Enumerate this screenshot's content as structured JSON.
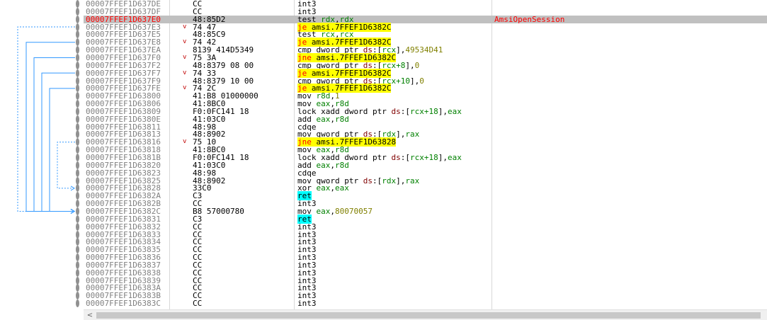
{
  "disassembly": {
    "rows": [
      {
        "addr": "00007FFEF1D637DE",
        "bytes": "CC",
        "expand": "",
        "instr": [
          {
            "t": "int3"
          }
        ],
        "comment": ""
      },
      {
        "addr": "00007FFEF1D637DF",
        "bytes": "CC",
        "expand": "",
        "instr": [
          {
            "t": "int3"
          }
        ],
        "comment": ""
      },
      {
        "addr": "00007FFEF1D637E0",
        "bytes": "48:85D2",
        "expand": "",
        "instr": [
          {
            "t": "test "
          },
          {
            "t": "rdx",
            "c": "reg"
          },
          {
            "t": ","
          },
          {
            "t": "rdx",
            "c": "reg"
          }
        ],
        "comment": "AmsiOpenSession",
        "selected": true,
        "rip": true
      },
      {
        "addr": "00007FFEF1D637E3",
        "bytes": "74 47",
        "expand": "v",
        "instr": [
          {
            "t": "je",
            "c": "jm"
          },
          {
            "t": " amsi.7FFEF1D6382C",
            "c": "jt"
          }
        ],
        "comment": ""
      },
      {
        "addr": "00007FFEF1D637E5",
        "bytes": "48:85C9",
        "expand": "",
        "instr": [
          {
            "t": "test "
          },
          {
            "t": "rcx",
            "c": "reg"
          },
          {
            "t": ","
          },
          {
            "t": "rcx",
            "c": "reg"
          }
        ],
        "comment": ""
      },
      {
        "addr": "00007FFEF1D637E8",
        "bytes": "74 42",
        "expand": "v",
        "instr": [
          {
            "t": "je",
            "c": "jm"
          },
          {
            "t": " amsi.7FFEF1D6382C",
            "c": "jt"
          }
        ],
        "comment": ""
      },
      {
        "addr": "00007FFEF1D637EA",
        "bytes": "8139 414D5349",
        "expand": "",
        "instr": [
          {
            "t": "cmp dword ptr "
          },
          {
            "t": "ds",
            "c": "seg"
          },
          {
            "t": ":["
          },
          {
            "t": "rcx",
            "c": "reg"
          },
          {
            "t": "],"
          },
          {
            "t": "49534D41",
            "c": "num"
          }
        ],
        "comment": ""
      },
      {
        "addr": "00007FFEF1D637F0",
        "bytes": "75 3A",
        "expand": "v",
        "instr": [
          {
            "t": "jne",
            "c": "jm"
          },
          {
            "t": " amsi.7FFEF1D6382C",
            "c": "jt"
          }
        ],
        "comment": ""
      },
      {
        "addr": "00007FFEF1D637F2",
        "bytes": "48:8379 08 00",
        "expand": "",
        "instr": [
          {
            "t": "cmp qword ptr "
          },
          {
            "t": "ds",
            "c": "seg"
          },
          {
            "t": ":["
          },
          {
            "t": "rcx+8",
            "c": "reg"
          },
          {
            "t": "],"
          },
          {
            "t": "0",
            "c": "num"
          }
        ],
        "comment": ""
      },
      {
        "addr": "00007FFEF1D637F7",
        "bytes": "74 33",
        "expand": "v",
        "instr": [
          {
            "t": "je",
            "c": "jm"
          },
          {
            "t": " amsi.7FFEF1D6382C",
            "c": "jt"
          }
        ],
        "comment": ""
      },
      {
        "addr": "00007FFEF1D637F9",
        "bytes": "48:8379 10 00",
        "expand": "",
        "instr": [
          {
            "t": "cmp qword ptr "
          },
          {
            "t": "ds",
            "c": "seg"
          },
          {
            "t": ":["
          },
          {
            "t": "rcx+10",
            "c": "reg"
          },
          {
            "t": "],"
          },
          {
            "t": "0",
            "c": "num"
          }
        ],
        "comment": ""
      },
      {
        "addr": "00007FFEF1D637FE",
        "bytes": "74 2C",
        "expand": "v",
        "instr": [
          {
            "t": "je",
            "c": "jm"
          },
          {
            "t": " amsi.7FFEF1D6382C",
            "c": "jt"
          }
        ],
        "comment": ""
      },
      {
        "addr": "00007FFEF1D63800",
        "bytes": "41:B8 01000000",
        "expand": "",
        "instr": [
          {
            "t": "mov "
          },
          {
            "t": "r8d",
            "c": "reg"
          },
          {
            "t": ","
          },
          {
            "t": "1",
            "c": "num"
          }
        ],
        "comment": ""
      },
      {
        "addr": "00007FFEF1D63806",
        "bytes": "41:8BC0",
        "expand": "",
        "instr": [
          {
            "t": "mov "
          },
          {
            "t": "eax",
            "c": "reg"
          },
          {
            "t": ","
          },
          {
            "t": "r8d",
            "c": "reg"
          }
        ],
        "comment": ""
      },
      {
        "addr": "00007FFEF1D63809",
        "bytes": "F0:0FC141 18",
        "expand": "",
        "instr": [
          {
            "t": "lock xadd dword ptr "
          },
          {
            "t": "ds",
            "c": "seg"
          },
          {
            "t": ":["
          },
          {
            "t": "rcx+18",
            "c": "reg"
          },
          {
            "t": "],"
          },
          {
            "t": "eax",
            "c": "reg"
          }
        ],
        "comment": ""
      },
      {
        "addr": "00007FFEF1D6380E",
        "bytes": "41:03C0",
        "expand": "",
        "instr": [
          {
            "t": "add "
          },
          {
            "t": "eax",
            "c": "reg"
          },
          {
            "t": ","
          },
          {
            "t": "r8d",
            "c": "reg"
          }
        ],
        "comment": ""
      },
      {
        "addr": "00007FFEF1D63811",
        "bytes": "48:98",
        "expand": "",
        "instr": [
          {
            "t": "cdqe"
          }
        ],
        "comment": ""
      },
      {
        "addr": "00007FFEF1D63813",
        "bytes": "48:8902",
        "expand": "",
        "instr": [
          {
            "t": "mov qword ptr "
          },
          {
            "t": "ds",
            "c": "seg"
          },
          {
            "t": ":["
          },
          {
            "t": "rdx",
            "c": "reg"
          },
          {
            "t": "],"
          },
          {
            "t": "rax",
            "c": "reg"
          }
        ],
        "comment": ""
      },
      {
        "addr": "00007FFEF1D63816",
        "bytes": "75 10",
        "expand": "v",
        "instr": [
          {
            "t": "jne",
            "c": "jm"
          },
          {
            "t": " amsi.7FFEF1D63828",
            "c": "jt"
          }
        ],
        "comment": ""
      },
      {
        "addr": "00007FFEF1D63818",
        "bytes": "41:8BC0",
        "expand": "",
        "instr": [
          {
            "t": "mov "
          },
          {
            "t": "eax",
            "c": "reg"
          },
          {
            "t": ","
          },
          {
            "t": "r8d",
            "c": "reg"
          }
        ],
        "comment": ""
      },
      {
        "addr": "00007FFEF1D6381B",
        "bytes": "F0:0FC141 18",
        "expand": "",
        "instr": [
          {
            "t": "lock xadd dword ptr "
          },
          {
            "t": "ds",
            "c": "seg"
          },
          {
            "t": ":["
          },
          {
            "t": "rcx+18",
            "c": "reg"
          },
          {
            "t": "],"
          },
          {
            "t": "eax",
            "c": "reg"
          }
        ],
        "comment": ""
      },
      {
        "addr": "00007FFEF1D63820",
        "bytes": "41:03C0",
        "expand": "",
        "instr": [
          {
            "t": "add "
          },
          {
            "t": "eax",
            "c": "reg"
          },
          {
            "t": ","
          },
          {
            "t": "r8d",
            "c": "reg"
          }
        ],
        "comment": ""
      },
      {
        "addr": "00007FFEF1D63823",
        "bytes": "48:98",
        "expand": "",
        "instr": [
          {
            "t": "cdqe"
          }
        ],
        "comment": ""
      },
      {
        "addr": "00007FFEF1D63825",
        "bytes": "48:8902",
        "expand": "",
        "instr": [
          {
            "t": "mov qword ptr "
          },
          {
            "t": "ds",
            "c": "seg"
          },
          {
            "t": ":["
          },
          {
            "t": "rdx",
            "c": "reg"
          },
          {
            "t": "],"
          },
          {
            "t": "rax",
            "c": "reg"
          }
        ],
        "comment": ""
      },
      {
        "addr": "00007FFEF1D63828",
        "bytes": "33C0",
        "expand": "",
        "instr": [
          {
            "t": "xor "
          },
          {
            "t": "eax",
            "c": "reg"
          },
          {
            "t": ","
          },
          {
            "t": "eax",
            "c": "reg"
          }
        ],
        "comment": ""
      },
      {
        "addr": "00007FFEF1D6382A",
        "bytes": "C3",
        "expand": "",
        "instr": [
          {
            "t": "ret",
            "c": "ret"
          }
        ],
        "comment": ""
      },
      {
        "addr": "00007FFEF1D6382B",
        "bytes": "CC",
        "expand": "",
        "instr": [
          {
            "t": "int3"
          }
        ],
        "comment": ""
      },
      {
        "addr": "00007FFEF1D6382C",
        "bytes": "B8 57000780",
        "expand": "",
        "instr": [
          {
            "t": "mov "
          },
          {
            "t": "eax",
            "c": "reg"
          },
          {
            "t": ","
          },
          {
            "t": "80070057",
            "c": "num"
          }
        ],
        "comment": ""
      },
      {
        "addr": "00007FFEF1D63831",
        "bytes": "C3",
        "expand": "",
        "instr": [
          {
            "t": "ret",
            "c": "ret"
          }
        ],
        "comment": ""
      },
      {
        "addr": "00007FFEF1D63832",
        "bytes": "CC",
        "expand": "",
        "instr": [
          {
            "t": "int3"
          }
        ],
        "comment": ""
      },
      {
        "addr": "00007FFEF1D63833",
        "bytes": "CC",
        "expand": "",
        "instr": [
          {
            "t": "int3"
          }
        ],
        "comment": ""
      },
      {
        "addr": "00007FFEF1D63834",
        "bytes": "CC",
        "expand": "",
        "instr": [
          {
            "t": "int3"
          }
        ],
        "comment": ""
      },
      {
        "addr": "00007FFEF1D63835",
        "bytes": "CC",
        "expand": "",
        "instr": [
          {
            "t": "int3"
          }
        ],
        "comment": ""
      },
      {
        "addr": "00007FFEF1D63836",
        "bytes": "CC",
        "expand": "",
        "instr": [
          {
            "t": "int3"
          }
        ],
        "comment": ""
      },
      {
        "addr": "00007FFEF1D63837",
        "bytes": "CC",
        "expand": "",
        "instr": [
          {
            "t": "int3"
          }
        ],
        "comment": ""
      },
      {
        "addr": "00007FFEF1D63838",
        "bytes": "CC",
        "expand": "",
        "instr": [
          {
            "t": "int3"
          }
        ],
        "comment": ""
      },
      {
        "addr": "00007FFEF1D63839",
        "bytes": "CC",
        "expand": "",
        "instr": [
          {
            "t": "int3"
          }
        ],
        "comment": ""
      },
      {
        "addr": "00007FFEF1D6383A",
        "bytes": "CC",
        "expand": "",
        "instr": [
          {
            "t": "int3"
          }
        ],
        "comment": ""
      },
      {
        "addr": "00007FFEF1D6383B",
        "bytes": "CC",
        "expand": "",
        "instr": [
          {
            "t": "int3"
          }
        ],
        "comment": ""
      },
      {
        "addr": "00007FFEF1D6383C",
        "bytes": "CC",
        "expand": "",
        "instr": [
          {
            "t": "int3"
          }
        ],
        "comment": ""
      }
    ],
    "jumps": [
      {
        "from": "00007FFEF1D637E3",
        "to": "00007FFEF1D6382C"
      },
      {
        "from": "00007FFEF1D637E8",
        "to": "00007FFEF1D6382C"
      },
      {
        "from": "00007FFEF1D637F0",
        "to": "00007FFEF1D6382C"
      },
      {
        "from": "00007FFEF1D637F7",
        "to": "00007FFEF1D6382C"
      },
      {
        "from": "00007FFEF1D637FE",
        "to": "00007FFEF1D6382C"
      },
      {
        "from": "00007FFEF1D63816",
        "to": "00007FFEF1D63828"
      }
    ]
  },
  "scrollbar": {
    "left_arrow": "<"
  },
  "colors": {
    "jump_line": "#3399ff",
    "selection": "#c0c0c0",
    "jump_highlight": "#ffff00",
    "ret_highlight": "#00ffff",
    "comment": "#ff0000"
  }
}
